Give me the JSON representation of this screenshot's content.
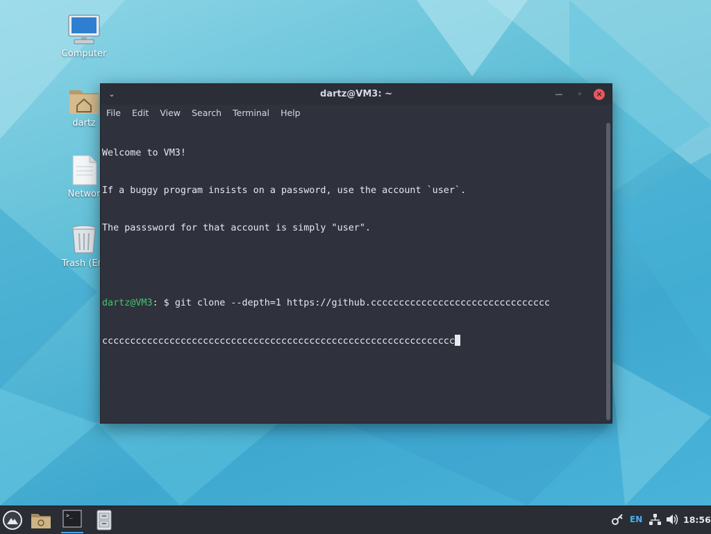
{
  "desktop": {
    "icons": [
      {
        "label": "Computer",
        "icon": "computer-icon"
      },
      {
        "label": "dartz",
        "icon": "home-folder-icon"
      },
      {
        "label": "Networ",
        "icon": "network-file-icon"
      },
      {
        "label": "Trash (Em",
        "icon": "trash-icon"
      }
    ]
  },
  "terminal": {
    "title": "dartz@VM3: ~",
    "menu": [
      "File",
      "Edit",
      "View",
      "Search",
      "Terminal",
      "Help"
    ],
    "lines": [
      "Welcome to VM3!",
      "If a buggy program insists on a password, use the account `user`.",
      "The passsword for that account is simply \"user\".",
      ""
    ],
    "prompt": {
      "user_host": "dartz@VM3",
      "suffix": ": $ ",
      "command_line1": "git clone --depth=1 https://github.cccccccccccccccccccccccccccccccc",
      "command_line2": "ccccccccccccccccccccccccccccccccccccccccccccccccccccccccccccccc"
    }
  },
  "taskbar": {
    "items": [
      "launcher-icon",
      "file-manager-icon",
      "terminal-icon",
      "file-cabinet-icon"
    ],
    "tray": {
      "language": "EN",
      "clock": "18:56"
    }
  },
  "colors": {
    "terminal_bg": "#2f323d",
    "prompt_green": "#43c46d",
    "close_red": "#e8575a",
    "taskbar_bg": "#2a2d34",
    "lang_blue": "#4ab0ee"
  }
}
